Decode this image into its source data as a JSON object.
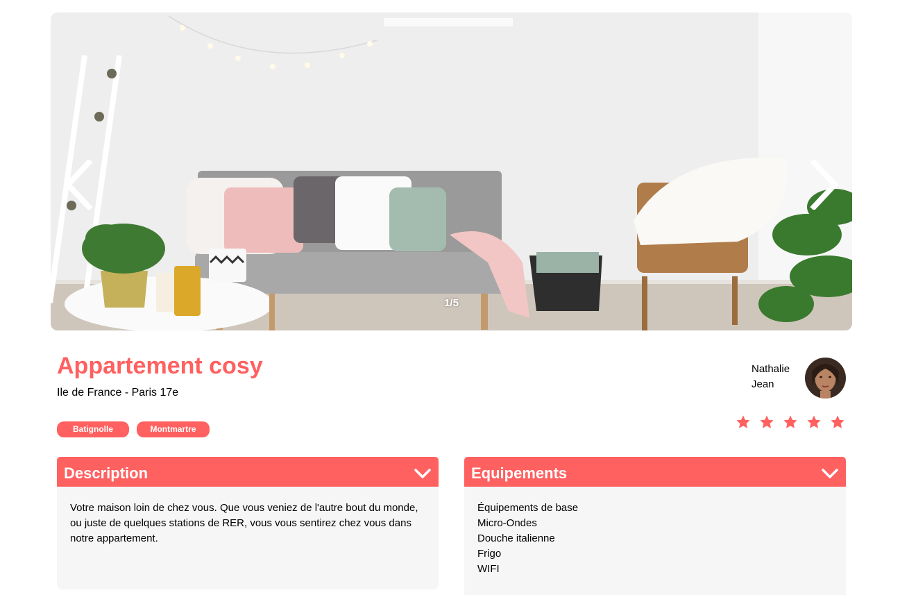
{
  "carousel": {
    "counter": "1/5",
    "prev_icon": "chevron-left-icon",
    "next_icon": "chevron-right-icon"
  },
  "listing": {
    "title": "Appartement cosy",
    "location": "Ile de France - Paris 17e",
    "tags": [
      "Batignolle",
      "Montmartre"
    ]
  },
  "host": {
    "first_name": "Nathalie",
    "last_name": "Jean"
  },
  "rating": {
    "value": 5,
    "max": 5,
    "icon": "star-icon"
  },
  "description": {
    "title": "Description",
    "text": "Votre maison loin de chez vous. Que vous veniez de l'autre bout du monde, ou juste de quelques stations de RER, vous vous sentirez chez vous dans notre appartement."
  },
  "equipements": {
    "title": "Equipements",
    "items": [
      "Équipements de base",
      "Micro-Ondes",
      "Douche italienne",
      "Frigo",
      "WIFI"
    ]
  },
  "colors": {
    "accent": "#FF6060",
    "panel_bg": "#F6F6F6"
  }
}
